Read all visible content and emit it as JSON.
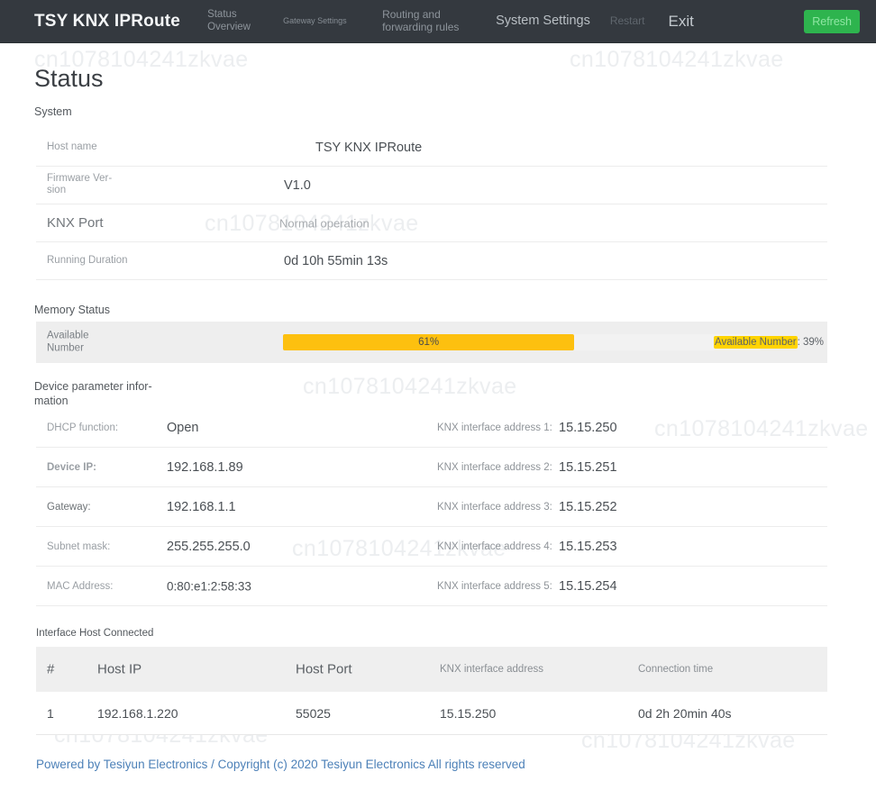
{
  "watermark": {
    "text": "cn1078104241zkvae"
  },
  "navbar": {
    "brand": "TSY KNX IPRoute",
    "links": [
      {
        "label": "Status Overview"
      },
      {
        "label": "Gateway Settings"
      },
      {
        "label": "Routing and forwarding rules"
      },
      {
        "label": "System Settings"
      },
      {
        "label": "Restart"
      },
      {
        "label": "Exit"
      }
    ],
    "refresh_label": "Refresh",
    "refresh_color": "#2eb44e",
    "background_color": "#34393f"
  },
  "page": {
    "title": "Status"
  },
  "system": {
    "heading": "System",
    "rows": [
      {
        "label": "Host name",
        "value": "TSY KNX IPRoute"
      },
      {
        "label": "Firmware Ver-\nsion",
        "value": "V1.0"
      },
      {
        "label": "KNX Port",
        "value": "Normal operation"
      },
      {
        "label": "Running Duration",
        "value": "0d 10h 55min 13s"
      }
    ]
  },
  "memory": {
    "heading": "Memory Status",
    "label": "Available\nNumber",
    "used_percent_label": "61%",
    "used_percent": 61,
    "right_highlight": "Available Number",
    "right_rest": ": 39%",
    "bar_color": "#fdc00f",
    "highlight_color": "#ffd400"
  },
  "device_params": {
    "heading": "Device parameter infor-\nmation",
    "rows": [
      {
        "label": "DHCP function:",
        "value": "Open",
        "right_label": "KNX interface address 1:",
        "right_value": "15.15.250"
      },
      {
        "label": "Device IP:",
        "value": "192.168.1.89",
        "right_label": "KNX interface address 2:",
        "right_value": "15.15.251"
      },
      {
        "label": "Gateway:",
        "value": "192.168.1.1",
        "right_label": "KNX interface address 3:",
        "right_value": "15.15.252"
      },
      {
        "label": "Subnet mask:",
        "value": "255.255.255.0",
        "right_label": "KNX interface address 4:",
        "right_value": "15.15.253"
      },
      {
        "label": "MAC Address:",
        "value": "0:80:e1:2:58:33",
        "right_label": "KNX interface address 5:",
        "right_value": "15.15.254"
      }
    ]
  },
  "host_table": {
    "heading": "Interface Host Connected",
    "columns": [
      "#",
      "Host IP",
      "Host Port",
      "KNX interface address",
      "Connection time"
    ],
    "rows": [
      {
        "num": "1",
        "host_ip": "192.168.1.220",
        "host_port": "55025",
        "knx_address": "15.15.250",
        "connection_time": "0d 2h 20min 40s"
      }
    ]
  },
  "footer": {
    "text": "Powered by Tesiyun Electronics / Copyright (c) 2020 Tesiyun Electronics All rights reserved",
    "color": "#4d81b8"
  }
}
